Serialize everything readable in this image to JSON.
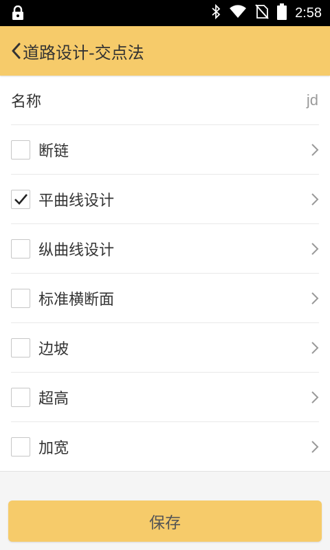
{
  "status_bar": {
    "time": "2:58",
    "icons": [
      "lock-icon",
      "bluetooth-icon",
      "wifi-icon",
      "no-sim-icon",
      "battery-icon"
    ]
  },
  "header": {
    "title": "道路设计-交点法",
    "back_icon": "chevron-left-icon",
    "color": "#f6cb6a"
  },
  "name_row": {
    "label": "名称",
    "value": "jd"
  },
  "items": [
    {
      "label": "断链",
      "checked": false
    },
    {
      "label": "平曲线设计",
      "checked": true
    },
    {
      "label": "纵曲线设计",
      "checked": false
    },
    {
      "label": "标准横断面",
      "checked": false
    },
    {
      "label": "边坡",
      "checked": false
    },
    {
      "label": "超高",
      "checked": false
    },
    {
      "label": "加宽",
      "checked": false
    }
  ],
  "save_button": {
    "label": "保存"
  }
}
